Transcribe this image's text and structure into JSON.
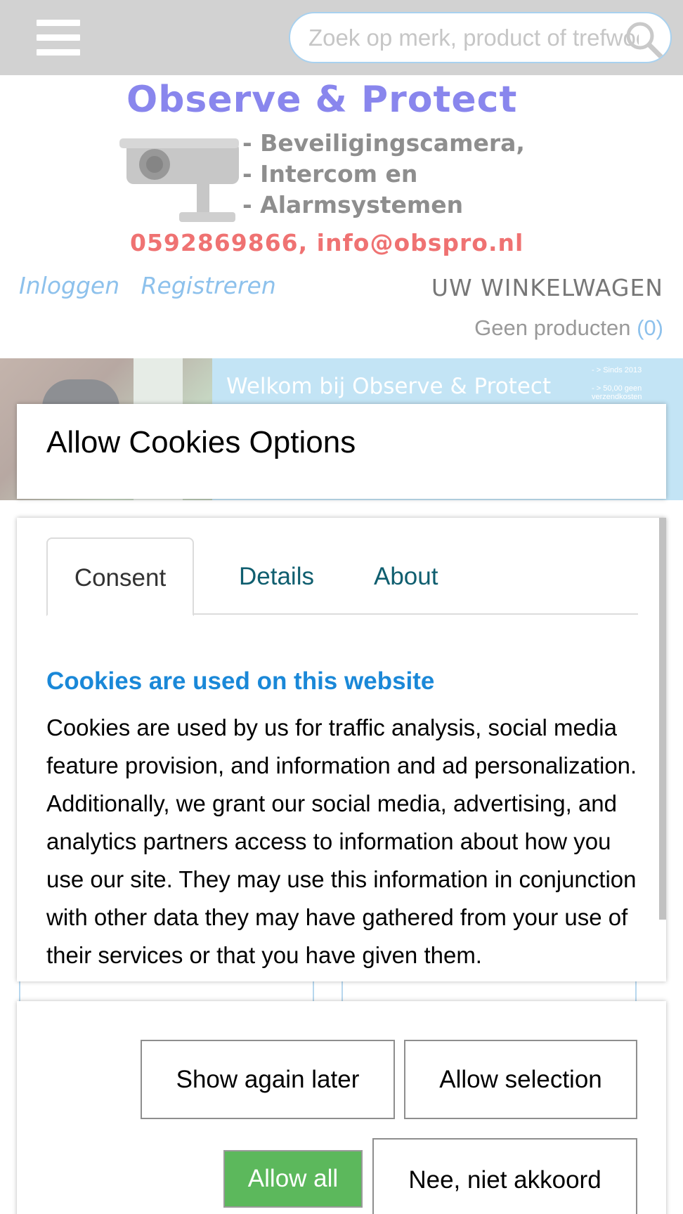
{
  "header": {
    "search_placeholder": "Zoek op merk, product of trefwoord"
  },
  "logo": {
    "title": "Observe & Protect",
    "lines": [
      "- Beveiligingscamera,",
      "- Intercom en",
      "- Alarmsystemen"
    ],
    "contact": "0592869866, info@obspro.nl"
  },
  "account": {
    "login": "Inloggen",
    "register": "Registreren"
  },
  "cart": {
    "title": "UW WINKELWAGEN",
    "status": "Geen producten",
    "count": "(0)"
  },
  "banner": {
    "welcome": "Welkom bij Observe & Protect",
    "since": "- > Sinds 2013",
    "shipping": "- > 50,00 geen verzendkosten"
  },
  "cookie_dialog": {
    "title": "Allow Cookies Options",
    "tabs": [
      {
        "label": "Consent",
        "active": true
      },
      {
        "label": "Details",
        "active": false
      },
      {
        "label": "About",
        "active": false
      }
    ],
    "section_title": "Cookies are used on this website",
    "section_text": "Cookies are used by us for traffic analysis, social media feature provision, and information and ad personalization. Additionally, we grant our social media, advertising, and analytics partners access to information about how you use our site. They may use this information in conjunction with other data they may have gathered from your use of their services or that you have given them.",
    "buttons": {
      "show_later": "Show again later",
      "allow_selection": "Allow selection",
      "allow_all": "Allow all",
      "deny": "Nee, niet akkoord"
    }
  },
  "colors": {
    "accent_blue": "#1a88d8",
    "tab_link": "#0f5e6f",
    "allow_all_green": "#5cb85c",
    "link_blue": "#8dc1ec",
    "topbar_gray": "#d2d2d2"
  }
}
